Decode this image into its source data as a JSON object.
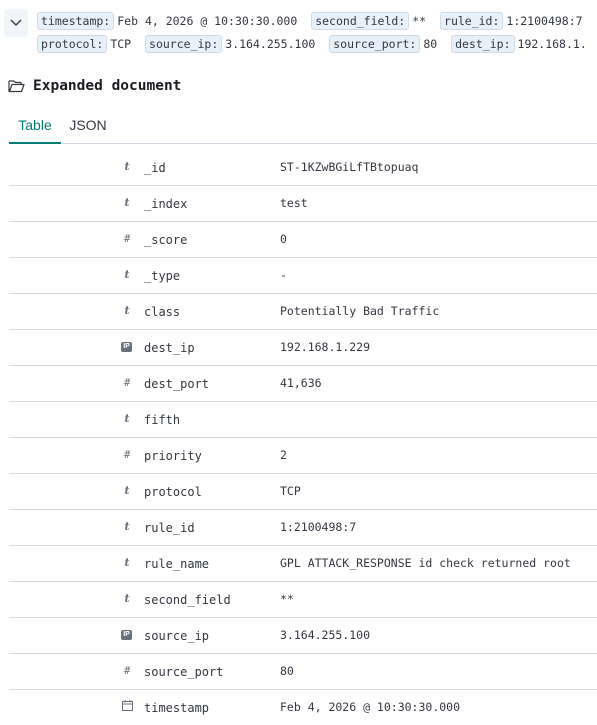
{
  "summary": {
    "pairs": [
      {
        "key": "timestamp:",
        "value": "Feb 4, 2026 @ 10:30:30.000"
      },
      {
        "key": "second_field:",
        "value": "**"
      },
      {
        "key": "rule_id:",
        "value": "1:2100498:7"
      },
      {
        "key": "protocol:",
        "value": "TCP"
      },
      {
        "key": "source_ip:",
        "value": "3.164.255.100"
      },
      {
        "key": "source_port:",
        "value": "80"
      },
      {
        "key": "dest_ip:",
        "value": "192.168.1."
      }
    ]
  },
  "expanded": {
    "title": "Expanded document",
    "tabs": [
      {
        "label": "Table",
        "active": true
      },
      {
        "label": "JSON",
        "active": false
      }
    ]
  },
  "fields": [
    {
      "type": "t",
      "name": "_id",
      "value": "ST-1KZwBGiLfTBtopuaq"
    },
    {
      "type": "t",
      "name": "_index",
      "value": "test"
    },
    {
      "type": "#",
      "name": "_score",
      "value": "0"
    },
    {
      "type": "t",
      "name": "_type",
      "value": " -"
    },
    {
      "type": "t",
      "name": "class",
      "value": "Potentially Bad Traffic"
    },
    {
      "type": "IP",
      "name": "dest_ip",
      "value": "192.168.1.229"
    },
    {
      "type": "#",
      "name": "dest_port",
      "value": "41,636"
    },
    {
      "type": "t",
      "name": "fifth",
      "value": ""
    },
    {
      "type": "#",
      "name": "priority",
      "value": "2"
    },
    {
      "type": "t",
      "name": "protocol",
      "value": "TCP"
    },
    {
      "type": "t",
      "name": "rule_id",
      "value": "1:2100498:7"
    },
    {
      "type": "t",
      "name": "rule_name",
      "value": "GPL ATTACK_RESPONSE id check returned root"
    },
    {
      "type": "t",
      "name": "second_field",
      "value": "**"
    },
    {
      "type": "IP",
      "name": "source_ip",
      "value": "3.164.255.100"
    },
    {
      "type": "#",
      "name": "source_port",
      "value": "80"
    },
    {
      "type": "date",
      "name": "timestamp",
      "value": "Feb 4, 2026 @ 10:30:30.000"
    }
  ]
}
